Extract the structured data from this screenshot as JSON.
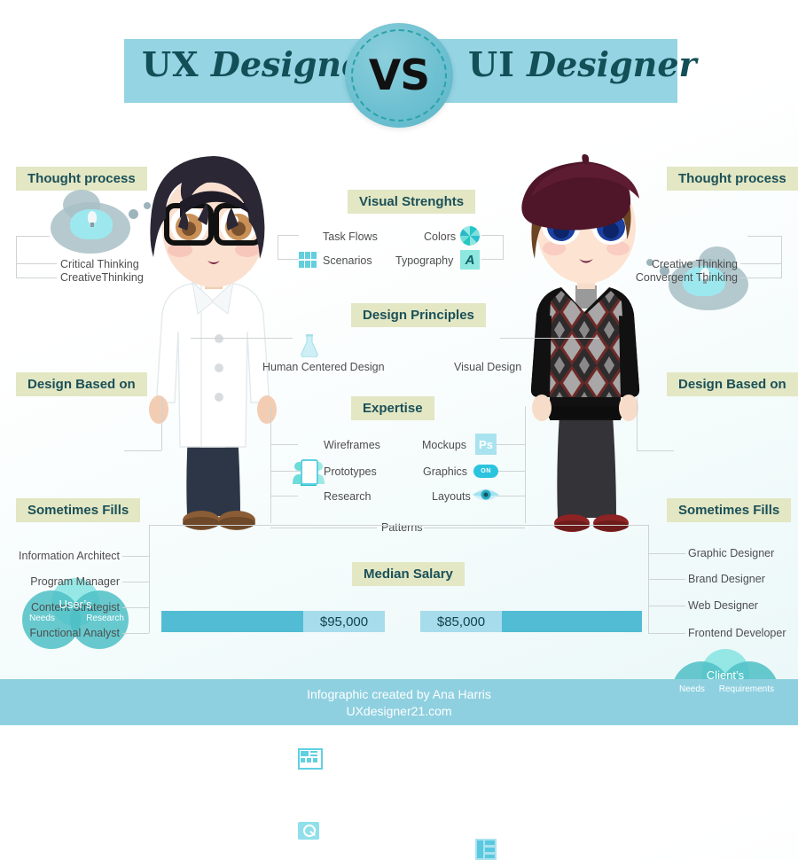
{
  "header": {
    "left_title_strong": "UX",
    "left_title_rest": "Designer",
    "vs": "VS",
    "right_title_strong": "UI",
    "right_title_rest": "Designer"
  },
  "sections": {
    "thought_process": "Thought process",
    "visual_strengths": "Visual Strenghts",
    "design_principles": "Design Principles",
    "design_based_on": "Design Based on",
    "expertise": "Expertise",
    "sometimes_fills": "Sometimes Fills",
    "median_salary": "Median Salary"
  },
  "left": {
    "thought_items": [
      "Critical Thinking",
      "CreativeThinking"
    ],
    "visual_strengths": [
      {
        "label": "Task Flows",
        "icon": "flask-icon"
      },
      {
        "label": "Scenarios",
        "icon": "grid-icon"
      }
    ],
    "design_principle": {
      "label": "Human Centered Design",
      "icon": "people-icon"
    },
    "venn": {
      "top": "User’s",
      "left": "Needs",
      "right": "Research"
    },
    "expertise": [
      {
        "label": "Wireframes",
        "icon": "wireframe-icon"
      },
      {
        "label": "Prototypes",
        "icon": "phone-icon"
      },
      {
        "label": "Research",
        "icon": "magnifier-icon"
      }
    ],
    "sometimes_fills": [
      "Information Architect",
      "Program Manager",
      "Content Strategist",
      "Functional Analyst"
    ],
    "salary": "$95,000"
  },
  "right": {
    "thought_items": [
      "Creative Thinking",
      "Convergent Thinking"
    ],
    "visual_strengths": [
      {
        "label": "Colors",
        "icon": "color-wheel-icon"
      },
      {
        "label": "Typography",
        "icon": "typography-a-icon"
      }
    ],
    "design_principle": {
      "label": "Visual Design",
      "icon": "eye-icon"
    },
    "venn": {
      "top": "Client’s",
      "left": "Needs",
      "right": "Requirements"
    },
    "expertise": [
      {
        "label": "Mockups",
        "icon": "photoshop-icon",
        "icon_text": "Ps"
      },
      {
        "label": "Graphics",
        "icon": "toggle-on-icon",
        "icon_text": "ON"
      },
      {
        "label": "Layouts",
        "icon": "layout-icon"
      }
    ],
    "sometimes_fills": [
      "Graphic Designer",
      "Brand Designer",
      "Web Designer",
      "Frontend Developer"
    ],
    "salary": "$85,000"
  },
  "shared": {
    "patterns": "Patterns"
  },
  "footer": {
    "credit": "Infographic created by Ana Harris",
    "site": "UXdesigner21.com"
  },
  "colors": {
    "header_band": "#95d4e3",
    "vs_badge": "#6bbfd0",
    "section_label_bg": "#e3e7c3",
    "section_label_text": "#1b5059",
    "bar_dark": "#52bcd5",
    "bar_light": "#a7dcec",
    "footer_bg": "#8ed0e0",
    "line": "#cfd3d4"
  }
}
